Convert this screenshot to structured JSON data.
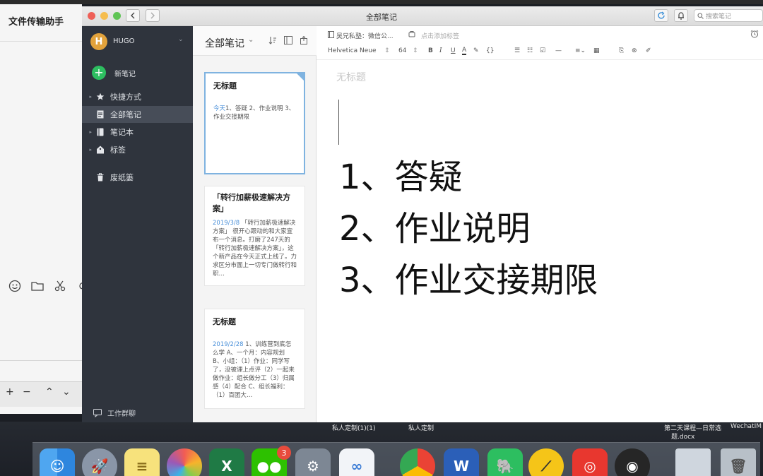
{
  "wechat": {
    "title": "文件传输助手",
    "bottom_plus": "+",
    "bottom_minus": "−",
    "bottom_up": "⌃",
    "bottom_down": "⌄"
  },
  "window": {
    "title": "全部笔记",
    "search_placeholder": "搜索笔记"
  },
  "sidebar": {
    "avatar_letter": "H",
    "user": "HUGO",
    "new_note": "新笔记",
    "items": [
      {
        "label": "快捷方式",
        "caret": "▸"
      },
      {
        "label": "全部笔记",
        "caret": ""
      },
      {
        "label": "笔记本",
        "caret": "▸"
      },
      {
        "label": "标签",
        "caret": "▸"
      },
      {
        "label": "废纸篓",
        "caret": ""
      }
    ],
    "bottom": "工作群聊"
  },
  "list": {
    "header": "全部笔记",
    "header_chevron": "⌄",
    "notes": [
      {
        "title": "无标题",
        "date": "今天",
        "summary": "1、答疑 2、作业说明 3、作业交接期限"
      },
      {
        "title": "「转行加薪极速解决方案」",
        "date": "2019/3/8",
        "summary": "「转行加薪极速解决方案」 很开心跟动的和大家宣布一个消息。打磨了247天的「转行加薪极速解决方案」，这个新产品在今天正式上线了。力求区分市面上一切专门做转行和职…"
      },
      {
        "title": "无标题",
        "date": "2019/2/28",
        "summary": "1、训练营到底怎么学 A、一个月：内容规划 B、小组：（1）作业：同学写了，没被课上点评（2）一起来做作业：组长做分工（3）归属感（4）配合 C、组长福利：（1）百团大…"
      }
    ]
  },
  "editor": {
    "notebook": "吴兄私塾：微信公...",
    "tag_hint": "点击添加标签",
    "font": "Helvetica Neue",
    "size": "64",
    "title_placeholder": "无标题",
    "lines": [
      "1、答疑",
      "2、作业说明",
      "3、作业交接期限"
    ]
  },
  "desktop": {
    "label1": "私人定制(1)(1)",
    "label2": "私人定制",
    "label3": "第二天课程—日常选",
    "label3b": "题.docx",
    "label4": "WechatIM"
  },
  "dock": {
    "badge": "3"
  }
}
